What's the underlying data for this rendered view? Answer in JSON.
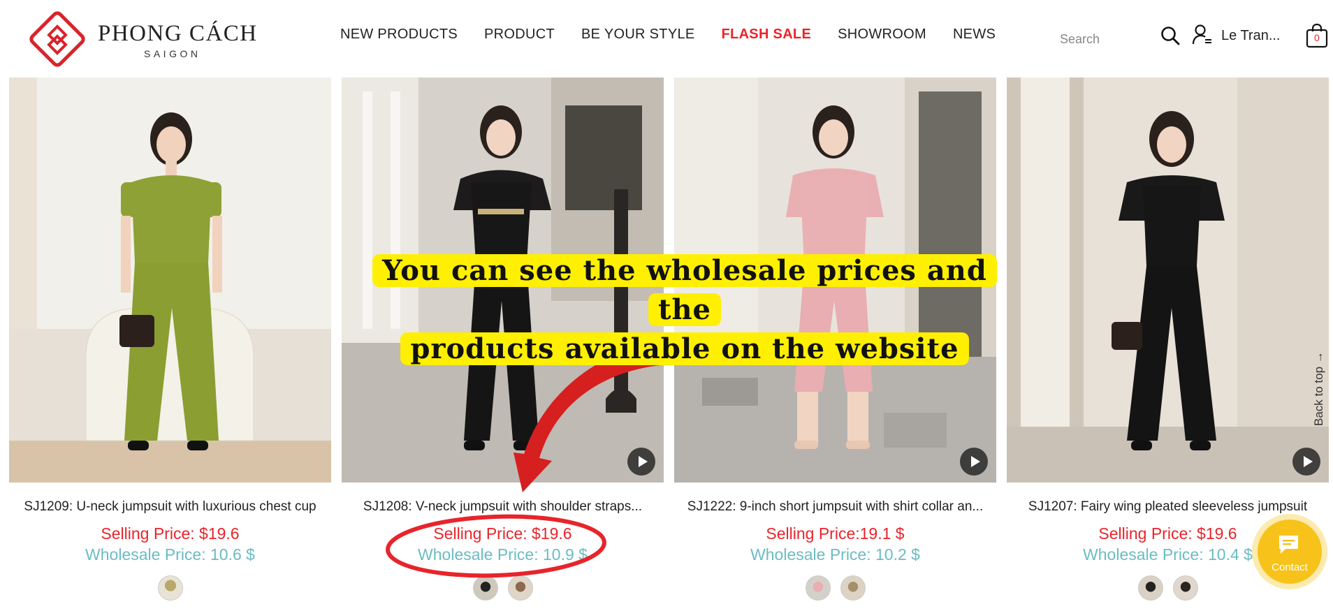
{
  "brand": {
    "name": "PHONG CÁCH",
    "sub": "SAIGON",
    "accent": "#e8242b"
  },
  "nav": {
    "items": [
      {
        "label": "NEW PRODUCTS"
      },
      {
        "label": "PRODUCT"
      },
      {
        "label": "BE YOUR STYLE"
      },
      {
        "label": "FLASH SALE"
      },
      {
        "label": "SHOWROOM"
      },
      {
        "label": "NEWS"
      }
    ]
  },
  "search": {
    "placeholder": "Search"
  },
  "user": {
    "name": "Le Tran..."
  },
  "cart": {
    "count": "0"
  },
  "products": [
    {
      "title": "SJ1209: U-neck jumpsuit with luxurious chest cup",
      "selling": "Selling Price: $19.6",
      "wholesale": "Wholesale Price: 10.6 $",
      "swatch_count": 1
    },
    {
      "title": "SJ1208: V-neck jumpsuit with shoulder straps...",
      "selling": "Selling Price: $19.6",
      "wholesale": "Wholesale Price: 10.9 $",
      "swatch_count": 2
    },
    {
      "title": "SJ1222: 9-inch short jumpsuit with shirt collar an...",
      "selling": "Selling Price:19.1 $",
      "wholesale": "Wholesale Price: 10.2 $",
      "swatch_count": 2
    },
    {
      "title": "SJ1207: Fairy wing pleated sleeveless jumpsuit",
      "selling": "Selling Price: $19.6",
      "wholesale": "Wholesale Price: 10.4 $",
      "swatch_count": 2
    }
  ],
  "callout": {
    "line1": "You can see the wholesale prices and the",
    "line2": "products available on the website",
    "highlight": "#ffef00"
  },
  "back_to_top": {
    "label": "Back to top →"
  },
  "contact": {
    "label": "Contact",
    "color": "#f7c31a"
  },
  "colors": {
    "selling": "#e8242b",
    "wholesale": "#6bbcc4",
    "annotation": "#e8242b"
  }
}
